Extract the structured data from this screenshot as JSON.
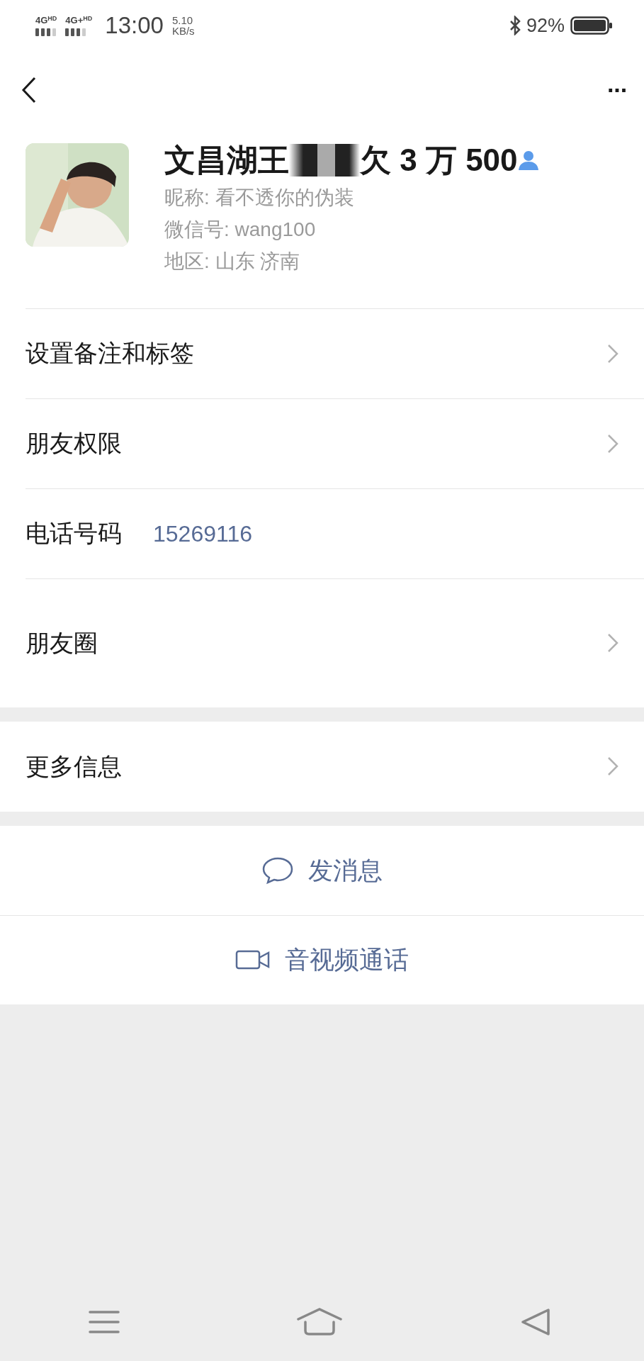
{
  "status_bar": {
    "network_1": "4G",
    "network_1_sup": "HD",
    "network_2": "4G+",
    "network_2_sup": "HD",
    "time": "13:00",
    "speed_value": "5.10",
    "speed_unit": "KB/s",
    "battery": "92%"
  },
  "header": {
    "more": "···"
  },
  "profile": {
    "name_start": "文昌湖王",
    "name_end": "欠 3 万 500",
    "nickname": "昵称: 看不透你的伪装",
    "wechat_id": "微信号: wang100",
    "region": "地区: 山东  济南"
  },
  "groups": [
    {
      "rows": [
        {
          "label": "设置备注和标签",
          "kind": "link"
        },
        {
          "label": "朋友权限",
          "kind": "link"
        },
        {
          "label": "电话号码",
          "value": "15269116",
          "kind": "value"
        },
        {
          "label": "朋友圈",
          "kind": "tall"
        }
      ]
    },
    {
      "rows": [
        {
          "label": "更多信息",
          "kind": "link"
        }
      ]
    }
  ],
  "actions": [
    {
      "label": "发消息",
      "kind": "message"
    },
    {
      "label": "音视频通话",
      "kind": "video"
    }
  ]
}
